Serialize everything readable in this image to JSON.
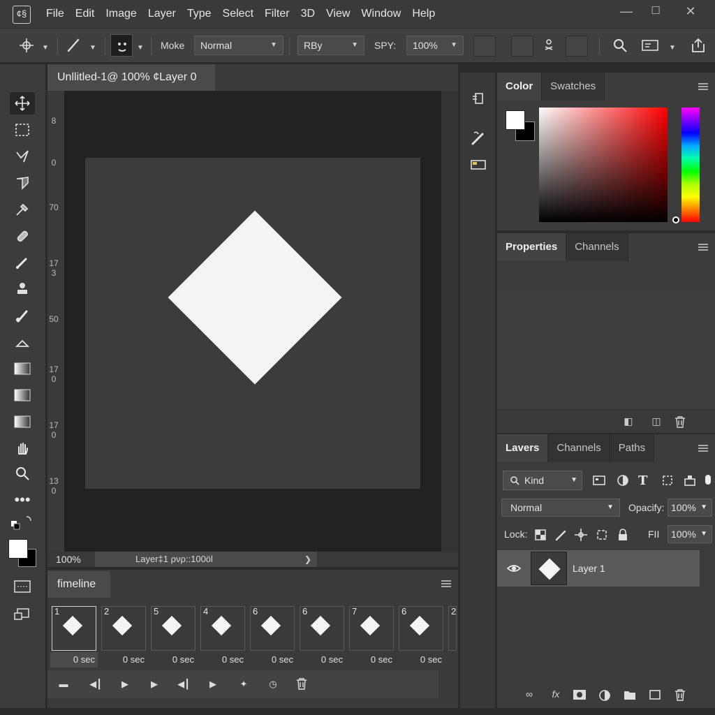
{
  "menubar": {
    "logo": "¢§",
    "items": [
      "File",
      "Edit",
      "Image",
      "Layer",
      "Type",
      "Select",
      "Filter",
      "3D",
      "View",
      "Window",
      "Help"
    ],
    "min": "—",
    "max": "☐",
    "close": "✕"
  },
  "options": {
    "mode_label": "Moke",
    "mode_value": "Normal",
    "second_dd": "RBy",
    "spy_label": "SPY:",
    "spy_value": "100%"
  },
  "document": {
    "tab_title": "Unllitled-1@ 100% ¢Layer 0",
    "ruler_marks": [
      "8",
      "0",
      "70",
      "17\n3",
      "50",
      "17\n0",
      "17\n0",
      "13\n0"
    ],
    "zoom": "100%",
    "status": "Layer‡1 ρνρ::100öl"
  },
  "timeline": {
    "tab": "fimeline",
    "frames": [
      {
        "num": "1",
        "delay": "0 sec"
      },
      {
        "num": "2",
        "delay": "0 sec"
      },
      {
        "num": "5",
        "delay": "0 sec"
      },
      {
        "num": "4",
        "delay": "0 sec"
      },
      {
        "num": "6",
        "delay": "0 sec"
      },
      {
        "num": "6",
        "delay": "0 sec"
      },
      {
        "num": "7",
        "delay": "0 sec"
      },
      {
        "num": "6",
        "delay": "0 sec"
      },
      {
        "num": "2",
        "delay": ""
      }
    ],
    "active_frame": 0
  },
  "color_panel": {
    "tabs": [
      "Color",
      "Swatches"
    ],
    "foreground": "#ffffff",
    "background": "#000000"
  },
  "properties_panel": {
    "tabs": [
      "Properties",
      "Channels"
    ]
  },
  "layers_panel": {
    "tabs": [
      "Lavers",
      "Channels",
      "Paths"
    ],
    "filter": "Kind",
    "blend_mode": "Normal",
    "opacity_label": "Opacify:",
    "opacity_value": "100%",
    "lock_label": "Lock:",
    "fill_label": "FII",
    "fill_value": "100%",
    "layer_name": "Layer 1"
  }
}
